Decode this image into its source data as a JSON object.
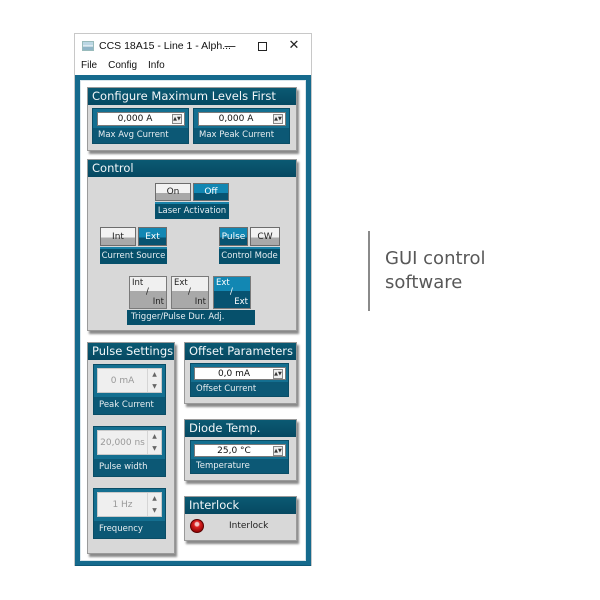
{
  "window": {
    "title": "CCS 18A15 - Line 1 - Alph...",
    "controls": {
      "minimize": "—",
      "close": "✕"
    }
  },
  "menu": [
    "File",
    "Config",
    "Info"
  ],
  "max_levels": {
    "title": "Configure Maximum Levels First",
    "avg": {
      "value": "0,000 A",
      "label": "Max Avg Current"
    },
    "peak": {
      "value": "0,000 A",
      "label": "Max Peak Current"
    }
  },
  "control": {
    "title": "Control",
    "laser": {
      "on": "On",
      "off": "Off",
      "label": "Laser Activation",
      "active": "Off"
    },
    "current_source": {
      "int": "Int",
      "ext": "Ext",
      "label": "Current Source",
      "active": "Ext"
    },
    "control_mode": {
      "pulse": "Pulse",
      "cw": "CW",
      "label": "Control Mode",
      "active": "Pulse"
    },
    "trigger": {
      "label": "Trigger/Pulse Dur. Adj.",
      "options": [
        {
          "a": "Int",
          "sep": "/",
          "b": "Int"
        },
        {
          "a": "Ext",
          "sep": "/",
          "b": "Int"
        },
        {
          "a": "Ext",
          "sep": "/",
          "b": "Ext"
        }
      ],
      "active": "Ext/Ext"
    }
  },
  "pulse": {
    "title": "Pulse Settings",
    "peak": {
      "value": "0 mA",
      "label": "Peak Current"
    },
    "width": {
      "value": "20,000 ns",
      "label": "Pulse width"
    },
    "freq": {
      "value": "1 Hz",
      "label": "Frequency"
    }
  },
  "offset": {
    "title": "Offset Parameters",
    "value": "0,0 mA",
    "label": "Offset Current"
  },
  "diode": {
    "title": "Diode Temp.",
    "value": "25,0 °C",
    "label": "Temperature"
  },
  "interlock": {
    "title": "Interlock",
    "label": "Interlock",
    "status_color": "#cc1111"
  },
  "caption": {
    "line1": "GUI control",
    "line2": "software"
  },
  "colors": {
    "accent": "#156a8d",
    "panel_head": "#064861",
    "active_btn": "#1287b3"
  }
}
